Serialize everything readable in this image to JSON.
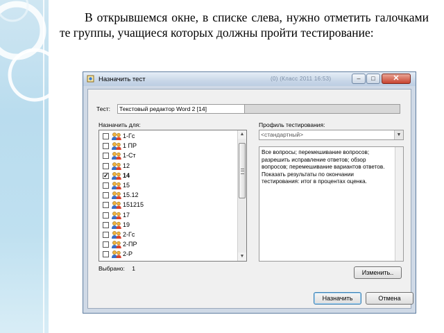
{
  "slide": {
    "text": "В открывшемся окне, в списке слева, нужно отметить галочками те группы, учащиеся которых должны пройти тестирование:"
  },
  "window": {
    "title": "Назначить тест",
    "title_extra": "(0)   (Класс 2011 16:53)",
    "min_label": "–",
    "max_label": "□",
    "close_label": "✕"
  },
  "form": {
    "test_label": "Тест:",
    "test_value": "Текстовый редактор Word 2 [14]",
    "assign_for_label": "Назначить для:",
    "groups": [
      {
        "label": "1-Гс",
        "checked": false
      },
      {
        "label": "1 ПР",
        "checked": false
      },
      {
        "label": "1-Ст",
        "checked": false
      },
      {
        "label": "12",
        "checked": false
      },
      {
        "label": "14",
        "checked": true
      },
      {
        "label": "15",
        "checked": false
      },
      {
        "label": "15.12",
        "checked": false
      },
      {
        "label": "151215",
        "checked": false
      },
      {
        "label": "17",
        "checked": false
      },
      {
        "label": "19",
        "checked": false
      },
      {
        "label": "2-Гс",
        "checked": false
      },
      {
        "label": "2-ПР",
        "checked": false
      },
      {
        "label": "2-Р",
        "checked": false
      }
    ],
    "selected_label": "Выбрано:",
    "selected_count": "1",
    "profile_label": "Профиль тестирования:",
    "profile_value": "<стандартный>",
    "profile_description": "    Все вопросы; перемешивание вопросов; разрешить исправление ответов; обзор вопросов; перемешивание вариантов ответов.\n    Показать результаты по окончании тестирования: итог в процентах оценка."
  },
  "buttons": {
    "change": "Изменить..",
    "assign": "Назначить",
    "cancel": "Отмена"
  },
  "colors": {
    "window_border": "#5f7da0",
    "client_bg": "#f0f0f0",
    "deco_bg": "#b9dcee"
  }
}
